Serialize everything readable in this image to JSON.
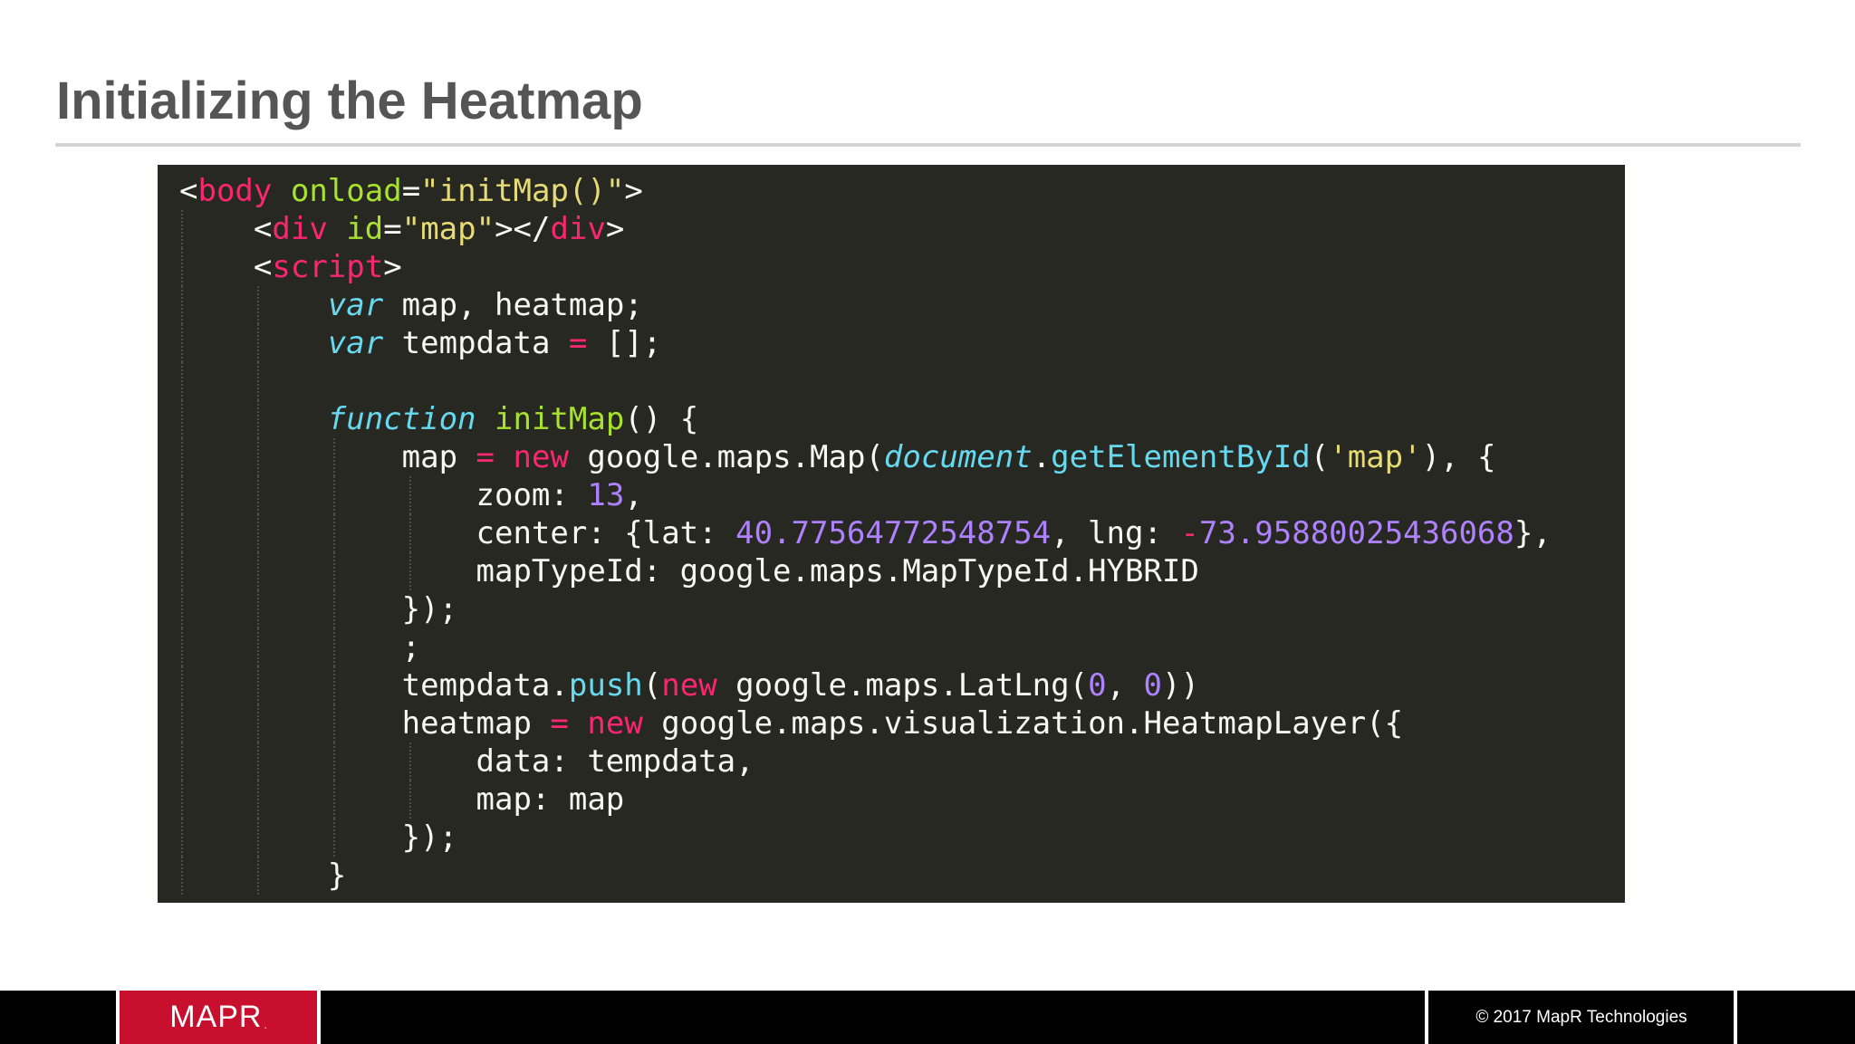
{
  "slide": {
    "title": "Initializing the Heatmap"
  },
  "code": {
    "theme": {
      "background": "#272822",
      "default": "#f8f8f2",
      "tag": "#f92672",
      "attr": "#a6e22e",
      "string": "#e6db74",
      "storage": "#66d9ef",
      "number": "#ae81ff"
    },
    "lines": [
      {
        "indent": 0,
        "tokens": [
          {
            "t": "<",
            "k": "punct"
          },
          {
            "t": "body",
            "k": "tag"
          },
          {
            "t": " ",
            "k": "punct"
          },
          {
            "t": "onload",
            "k": "attr"
          },
          {
            "t": "=",
            "k": "punct"
          },
          {
            "t": "\"initMap()\"",
            "k": "str"
          },
          {
            "t": ">",
            "k": "punct"
          }
        ]
      },
      {
        "indent": 1,
        "tokens": [
          {
            "t": "<",
            "k": "punct"
          },
          {
            "t": "div",
            "k": "tag"
          },
          {
            "t": " ",
            "k": "punct"
          },
          {
            "t": "id",
            "k": "attr"
          },
          {
            "t": "=",
            "k": "punct"
          },
          {
            "t": "\"map\"",
            "k": "str"
          },
          {
            "t": "></",
            "k": "punct"
          },
          {
            "t": "div",
            "k": "tag"
          },
          {
            "t": ">",
            "k": "punct"
          }
        ]
      },
      {
        "indent": 1,
        "tokens": [
          {
            "t": "<",
            "k": "punct"
          },
          {
            "t": "script",
            "k": "tag"
          },
          {
            "t": ">",
            "k": "punct"
          }
        ]
      },
      {
        "indent": 2,
        "tokens": [
          {
            "t": "var",
            "k": "storage"
          },
          {
            "t": " map, heatmap;",
            "k": "ident"
          }
        ]
      },
      {
        "indent": 2,
        "tokens": [
          {
            "t": "var",
            "k": "storage"
          },
          {
            "t": " tempdata ",
            "k": "ident"
          },
          {
            "t": "=",
            "k": "op"
          },
          {
            "t": " [];",
            "k": "ident"
          }
        ]
      },
      {
        "indent": 2,
        "tokens": []
      },
      {
        "indent": 2,
        "tokens": [
          {
            "t": "function",
            "k": "storage"
          },
          {
            "t": " ",
            "k": "ident"
          },
          {
            "t": "initMap",
            "k": "fn"
          },
          {
            "t": "() {",
            "k": "ident"
          }
        ]
      },
      {
        "indent": 3,
        "tokens": [
          {
            "t": "map ",
            "k": "ident"
          },
          {
            "t": "=",
            "k": "op"
          },
          {
            "t": " ",
            "k": "ident"
          },
          {
            "t": "new",
            "k": "op"
          },
          {
            "t": " google.maps.Map(",
            "k": "ident"
          },
          {
            "t": "document",
            "k": "storage"
          },
          {
            "t": ".",
            "k": "ident"
          },
          {
            "t": "getElementById",
            "k": "builtin"
          },
          {
            "t": "(",
            "k": "ident"
          },
          {
            "t": "'map'",
            "k": "str"
          },
          {
            "t": "), {",
            "k": "ident"
          }
        ]
      },
      {
        "indent": 4,
        "tokens": [
          {
            "t": "zoom: ",
            "k": "ident"
          },
          {
            "t": "13",
            "k": "num"
          },
          {
            "t": ",",
            "k": "ident"
          }
        ]
      },
      {
        "indent": 4,
        "tokens": [
          {
            "t": "center: {lat: ",
            "k": "ident"
          },
          {
            "t": "40.77564772548754",
            "k": "num"
          },
          {
            "t": ", lng: ",
            "k": "ident"
          },
          {
            "t": "-",
            "k": "op"
          },
          {
            "t": "73.95880025436068",
            "k": "num"
          },
          {
            "t": "},",
            "k": "ident"
          }
        ]
      },
      {
        "indent": 4,
        "tokens": [
          {
            "t": "mapTypeId: google.maps.MapTypeId.HYBRID",
            "k": "ident"
          }
        ]
      },
      {
        "indent": 3,
        "tokens": [
          {
            "t": "});",
            "k": "ident"
          }
        ]
      },
      {
        "indent": 3,
        "tokens": [
          {
            "t": ";",
            "k": "ident"
          }
        ]
      },
      {
        "indent": 3,
        "tokens": [
          {
            "t": "tempdata.",
            "k": "ident"
          },
          {
            "t": "push",
            "k": "builtin"
          },
          {
            "t": "(",
            "k": "ident"
          },
          {
            "t": "new",
            "k": "op"
          },
          {
            "t": " google.maps.LatLng(",
            "k": "ident"
          },
          {
            "t": "0",
            "k": "num"
          },
          {
            "t": ", ",
            "k": "ident"
          },
          {
            "t": "0",
            "k": "num"
          },
          {
            "t": "))",
            "k": "ident"
          }
        ]
      },
      {
        "indent": 3,
        "tokens": [
          {
            "t": "heatmap ",
            "k": "ident"
          },
          {
            "t": "=",
            "k": "op"
          },
          {
            "t": " ",
            "k": "ident"
          },
          {
            "t": "new",
            "k": "op"
          },
          {
            "t": " google.maps.visualization.HeatmapLayer({",
            "k": "ident"
          }
        ]
      },
      {
        "indent": 4,
        "tokens": [
          {
            "t": "data: tempdata,",
            "k": "ident"
          }
        ]
      },
      {
        "indent": 4,
        "tokens": [
          {
            "t": "map: map",
            "k": "ident"
          }
        ]
      },
      {
        "indent": 3,
        "tokens": [
          {
            "t": "});",
            "k": "ident"
          }
        ]
      },
      {
        "indent": 2,
        "tokens": [
          {
            "t": "}",
            "k": "ident"
          }
        ]
      }
    ]
  },
  "footer": {
    "logo_text": "MAPR",
    "logo_mark": ".",
    "copyright": "© 2017 MapR Technologies",
    "brand_color": "#c8102e",
    "bar_color": "#000000"
  }
}
